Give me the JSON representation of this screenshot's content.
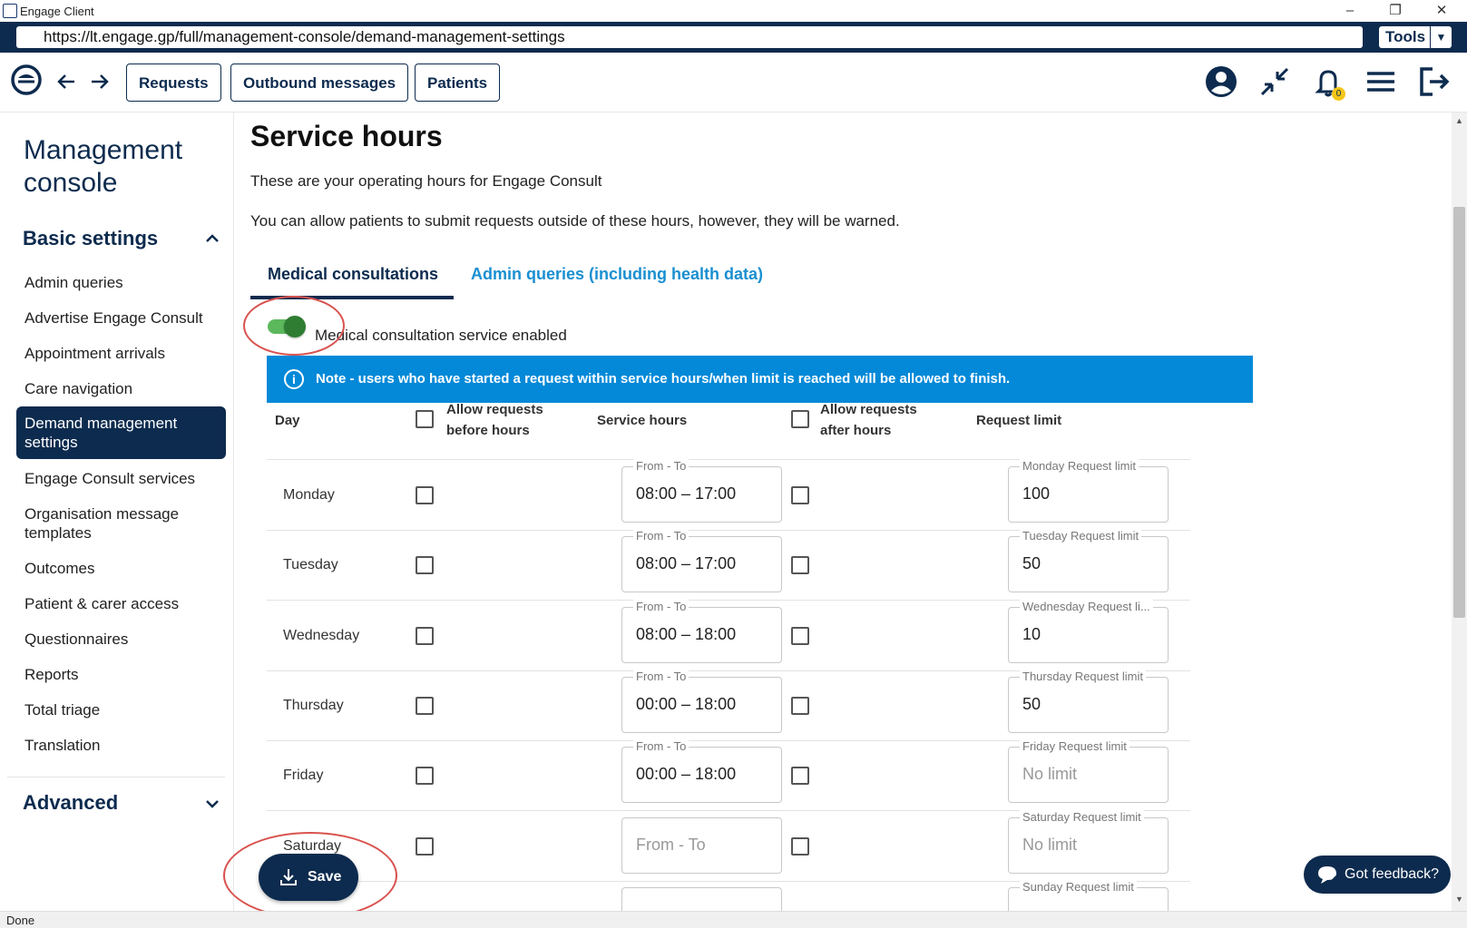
{
  "window": {
    "title": "Engage Client"
  },
  "browser": {
    "url": "https://lt.engage.gp/full/management-console/demand-management-settings",
    "tools_label": "Tools"
  },
  "header": {
    "nav": [
      "Requests",
      "Outbound messages",
      "Patients"
    ],
    "notification_count": "0"
  },
  "sidebar": {
    "title": "Management console",
    "basic_settings": "Basic settings",
    "items": [
      "Admin queries",
      "Advertise Engage Consult",
      "Appointment arrivals",
      "Care navigation",
      "Demand management settings",
      "Engage Consult services",
      "Organisation message templates",
      "Outcomes",
      "Patient & carer access",
      "Questionnaires",
      "Reports",
      "Total triage",
      "Translation"
    ],
    "active_index": 4,
    "advanced": "Advanced"
  },
  "main": {
    "title": "Service hours",
    "intro": "These are your operating hours for Engage Consult",
    "intro2": "You can allow patients to submit requests outside of these hours, however, they will be warned.",
    "tabs": [
      "Medical consultations",
      "Admin queries (including health data)"
    ],
    "active_tab": 0,
    "toggle_label": "Medical consultation service enabled",
    "toggle_on": true,
    "note": "Note - users who have started a request within service hours/when limit is reached will be allowed to finish.",
    "columns": {
      "day": "Day",
      "before": "Allow requests before hours",
      "hours": "Service hours",
      "after": "Allow requests after hours",
      "limit": "Request limit"
    },
    "rows": [
      {
        "day": "Monday",
        "hours_label": "From - To",
        "hours": "08:00 – 17:00",
        "limit_label": "Monday Request limit",
        "limit": "100"
      },
      {
        "day": "Tuesday",
        "hours_label": "From - To",
        "hours": "08:00 – 17:00",
        "limit_label": "Tuesday Request limit",
        "limit": "50"
      },
      {
        "day": "Wednesday",
        "hours_label": "From - To",
        "hours": "08:00 – 18:00",
        "limit_label": "Wednesday Request li...",
        "limit": "10"
      },
      {
        "day": "Thursday",
        "hours_label": "From - To",
        "hours": "00:00 – 18:00",
        "limit_label": "Thursday Request limit",
        "limit": "50"
      },
      {
        "day": "Friday",
        "hours_label": "From - To",
        "hours": "00:00 – 18:00",
        "limit_label": "Friday Request limit",
        "limit_placeholder": "No limit"
      },
      {
        "day": "Saturday",
        "hours_placeholder": "From - To",
        "limit_label": "Saturday Request limit",
        "limit_placeholder": "No limit"
      },
      {
        "day": "Sunday",
        "limit_label": "Sunday Request limit"
      }
    ],
    "save_label": "Save",
    "feedback_label": "Got feedback?"
  },
  "status": {
    "text": "Done"
  },
  "colors": {
    "navy": "#0d2b4e",
    "accent_blue": "#0389d8",
    "toggle_green": "#2e7d32",
    "annotation_red": "#d9534f"
  }
}
